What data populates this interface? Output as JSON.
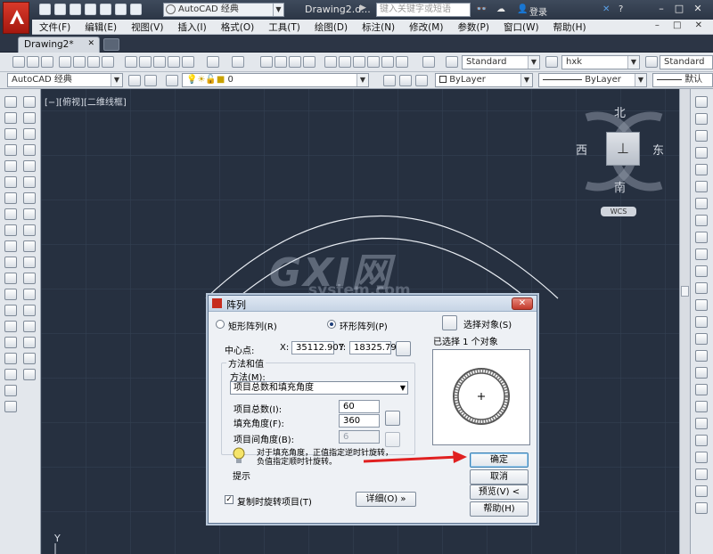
{
  "titlebar": {
    "workspace": "AutoCAD 经典",
    "window_title": "Drawing2.d...",
    "search_placeholder": "键入关键字或短语",
    "login": "登录"
  },
  "menu": [
    "文件(F)",
    "编辑(E)",
    "视图(V)",
    "插入(I)",
    "格式(O)",
    "工具(T)",
    "绘图(D)",
    "标注(N)",
    "修改(M)",
    "参数(P)",
    "窗口(W)",
    "帮助(H)"
  ],
  "tabs": {
    "active": "Drawing2*"
  },
  "toolbar": {
    "text_style": "Standard",
    "dim_style": "hxk",
    "table_style": "Standard",
    "workspace_combo": "AutoCAD 经典",
    "layer": "0",
    "color": "ByLayer",
    "linetype": "ByLayer",
    "lineweight": "默认"
  },
  "viewport": {
    "label": "[−][俯视][二维线框]",
    "compass": {
      "north": "北",
      "south": "南",
      "east": "东",
      "west": "西"
    },
    "wcs": "WCS",
    "ucs_y": "Y"
  },
  "watermark": {
    "main": "GXI网",
    "sub": "system.com"
  },
  "dialog": {
    "title": "阵列",
    "rect_array": "矩形阵列(R)",
    "polar_array": "环形阵列(P)",
    "select_objects": "选择对象(S)",
    "selected_count": "已选择 1 个对象",
    "center_label": "中心点:",
    "x_label": "X:",
    "x_value": "35112.907",
    "y_label": "Y:",
    "y_value": "18325.793",
    "method_group": "方法和值",
    "method_label": "方法(M):",
    "method_value": "项目总数和填充角度",
    "total_items_label": "项目总数(I):",
    "total_items_value": "60",
    "fill_angle_label": "填充角度(F):",
    "fill_angle_value": "360",
    "item_angle_label": "项目间角度(B):",
    "item_angle_value": "6",
    "tip_text": "对于填充角度，正值指定逆时针旋转，负值指定顺时针旋转。",
    "tip_label": "提示",
    "rotate_items": "复制时旋转项目(T)",
    "details": "详细(O)",
    "ok": "确定",
    "cancel": "取消",
    "preview": "预览(V)",
    "help": "帮助(H)"
  },
  "colors": {
    "canvas": "#263040",
    "dialog_bg": "#eef1f5",
    "arrow": "#e02020",
    "logo_red": "#c62c1e"
  }
}
